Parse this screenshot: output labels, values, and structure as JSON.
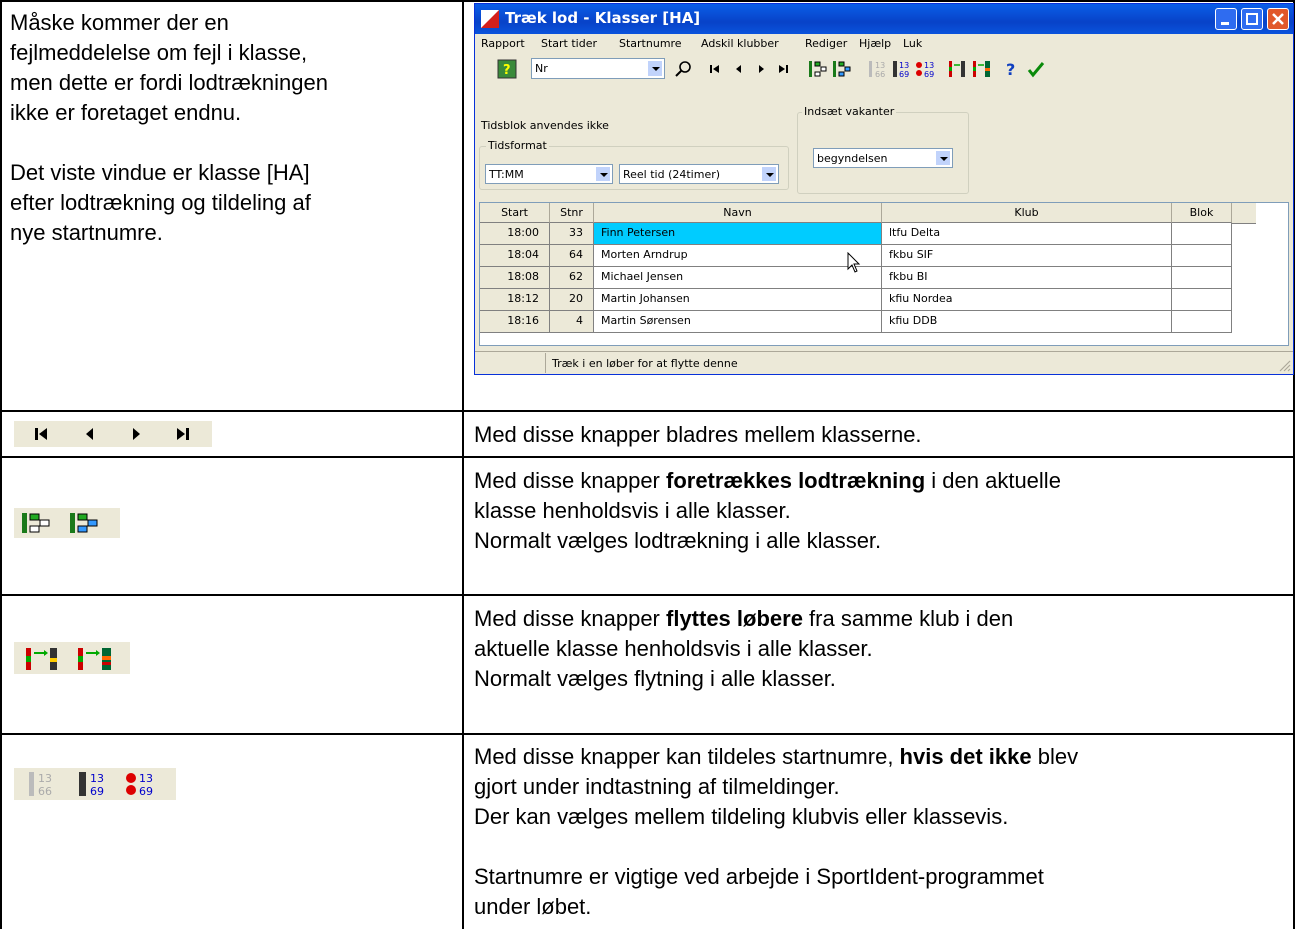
{
  "doc": {
    "intro_text": "Måske kommer der en\nfejlmeddelelse om fejl i klasse,\nmen dette er fordi lodtrækningen\nikke er foretaget endnu.\n\nDet viste vindue er klasse [HA]\nefter lodtrækning og tildeling af\nnye startnumre.",
    "row_nav_text": "Med disse knapper bladres mellem klasserne.",
    "row_draw_text_pre": "Med disse knapper ",
    "row_draw_text_bold": "foretrækkes lodtrækning",
    "row_draw_text_post": " i den aktuelle\nklasse henholdsvis i alle klasser.\nNormalt vælges lodtrækning i alle klasser.",
    "row_move_text_pre": "Med disse knapper ",
    "row_move_text_bold": "flyttes løbere",
    "row_move_text_post": " fra samme klub i den\naktuelle klasse henholdsvis i alle klasser.\nNormalt vælges flytning i alle klasser.",
    "row_numbers_text_pre": "Med disse knapper kan tildeles startnumre, ",
    "row_numbers_text_bold": "hvis det ikke",
    "row_numbers_text_post": " blev\ngjort under indtastning af tilmeldinger.\nDer kan vælges mellem tildeling klubvis eller klassevis.\n\nStartnumre er vigtige ved arbejde i SportIdent-programmet\nunder løbet."
  },
  "window": {
    "title": "Træk lod - Klasser [HA]",
    "menu": [
      "Rapport",
      "Start tider",
      "Startnumre",
      "Adskil klubber",
      "Rediger",
      "Hjælp",
      "Luk"
    ],
    "search_combo_value": "Nr",
    "tidsblok_text": "Tidsblok anvendes ikke",
    "tidsformat_label": "Tidsformat",
    "tidsformat_value": "TT:MM",
    "tidstype_value": "Reel tid (24timer)",
    "vakanter_label": "Indsæt vakanter",
    "vakanter_value": "begyndelsen",
    "status_text": "Træk i en løber for at flytte denne",
    "columns": [
      "Start",
      "Stnr",
      "Navn",
      "Klub",
      "Blok"
    ],
    "rows": [
      {
        "start": "18:00",
        "stnr": "33",
        "navn": "Finn Petersen",
        "klub": "ltfu Delta",
        "blok": ""
      },
      {
        "start": "18:04",
        "stnr": "64",
        "navn": "Morten Arndrup",
        "klub": "fkbu SIF",
        "blok": ""
      },
      {
        "start": "18:08",
        "stnr": "62",
        "navn": "Michael Jensen",
        "klub": "fkbu BI",
        "blok": ""
      },
      {
        "start": "18:12",
        "stnr": "20",
        "navn": "Martin Johansen",
        "klub": "kfiu Nordea",
        "blok": ""
      },
      {
        "start": "18:16",
        "stnr": "4",
        "navn": "Martin Sørensen",
        "klub": "kfiu DDB",
        "blok": ""
      }
    ],
    "toolbar_icons": [
      "help-book-icon",
      "search-icon",
      "first-icon",
      "previous-icon",
      "next-icon",
      "last-icon",
      "draw-class-icon",
      "draw-all-icon",
      "numbers-disabled-icon",
      "numbers-club-icon",
      "numbers-class-icon",
      "move-class-icon",
      "move-all-icon",
      "question-icon",
      "check-icon"
    ]
  },
  "icons": {
    "nav": [
      "first-icon",
      "previous-icon",
      "next-icon",
      "last-icon"
    ],
    "draw": [
      "draw-class-icon",
      "draw-all-icon"
    ],
    "move": [
      "move-class-icon",
      "move-all-icon"
    ],
    "numbers": [
      "numbers-disabled-icon",
      "numbers-club-icon",
      "numbers-class-icon"
    ]
  }
}
